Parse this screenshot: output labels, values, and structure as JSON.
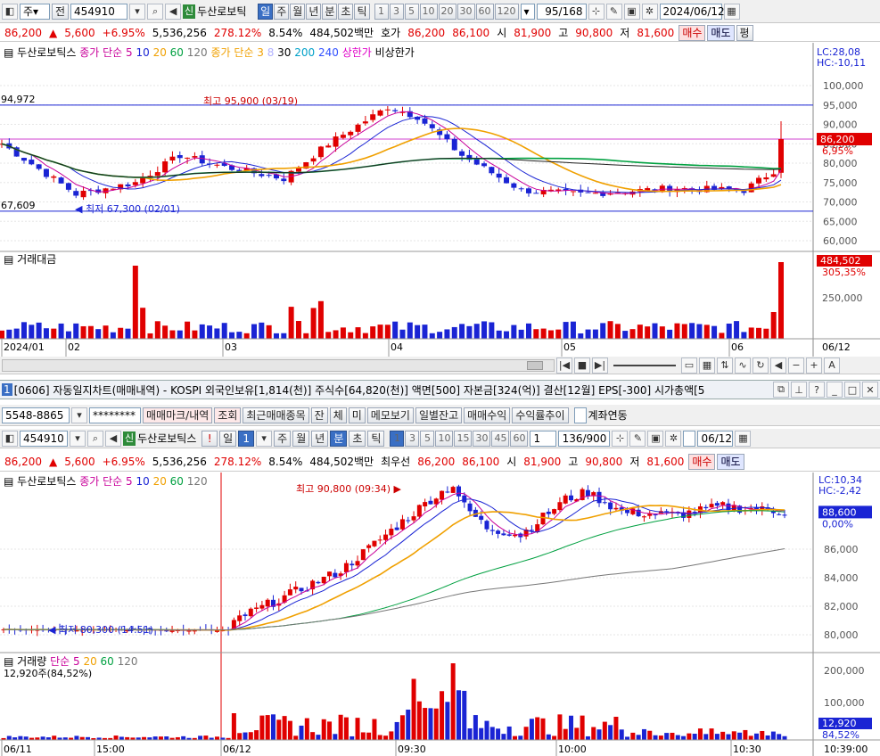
{
  "top": {
    "toolbar": {
      "jong": "주",
      "jeon": "전",
      "code": "454910",
      "sin": "신",
      "name": "두산로보틱",
      "periods": [
        "일",
        "주",
        "월",
        "년",
        "분",
        "초",
        "틱"
      ],
      "active_period": "일",
      "nums": [
        "1",
        "3",
        "5",
        "10",
        "20",
        "30",
        "60",
        "120"
      ],
      "count": "95/168",
      "date": "2024/06/12"
    },
    "quote": {
      "price": "86,200",
      "arrow": "▲",
      "change": "5,600",
      "pct": "+6.95%",
      "volume": "5,536,256",
      "vol_ratio": "278.12%",
      "turnover": "8.54%",
      "amount": "484,502백만",
      "hoga_label": "호가",
      "hoga1": "86,200",
      "hoga2": "86,100",
      "open_label": "시",
      "open": "81,900",
      "high_label": "고",
      "high": "90,800",
      "low_label": "저",
      "low": "81,600",
      "buy": "매수",
      "sell": "매도",
      "avg": "평"
    },
    "legend": {
      "name": "두산로보틱스",
      "ma1": "종가 단순 5",
      "ma1_vals": [
        "10",
        "20",
        "60",
        "120"
      ],
      "ma2": "종가 단순 3",
      "ma2_vals": [
        "8",
        "30",
        "200",
        "240"
      ],
      "upper": "상한가",
      "lower": "비상한가"
    },
    "yaxis": [
      "100,000",
      "95,000",
      "90,000",
      "85,000",
      "80,000",
      "75,000",
      "70,000",
      "65,000",
      "60,000"
    ],
    "lc": "LC:28,08",
    "hc": "HC:-10,11",
    "cur_price": "86,200",
    "cur_pct": "6,95%",
    "left_high": "94,972",
    "left_low": "67,609",
    "high_note": "최고 95,900 (03/19)",
    "low_note": "최저 67,300 (02/01)",
    "vol_label": "거래대금",
    "vol_cur": "484,502",
    "vol_pct": "305,35%",
    "vol_tick": "250,000",
    "xaxis": [
      "2024/01",
      "02",
      "03",
      "04",
      "05",
      "06"
    ],
    "xend": "06/12"
  },
  "window": {
    "title": "[0606] 자동일지차트(매매내역) - KOSPI 외국인보유[1,814(천)] 주식수[64,820(천)] 액면[500] 자본금[324(억)] 결산[12월] EPS[-300] 시가총액[5"
  },
  "bottom": {
    "account": "5548-8865",
    "password": "********",
    "buttons": [
      "매매마크/내역",
      "조회",
      "최근매매종목",
      "잔",
      "체",
      "미",
      "메모보기",
      "일별잔고",
      "매매수익",
      "수익률추이"
    ],
    "link": "계좌연동",
    "toolbar": {
      "code": "454910",
      "sin": "신",
      "name": "두산로보틱스",
      "excl": "!",
      "period": "일",
      "nums": [
        "1",
        "3",
        "5",
        "10",
        "15",
        "30",
        "45",
        "60"
      ],
      "sel": "1",
      "count": "136/900",
      "date": "06/12"
    },
    "quote": {
      "price": "86,200",
      "arrow": "▲",
      "change": "5,600",
      "pct": "+6.95%",
      "volume": "5,536,256",
      "vol_ratio": "278.12%",
      "turnover": "8.54%",
      "amount": "484,502백만",
      "best_label": "최우선",
      "b1": "86,200",
      "b2": "86,100",
      "open_label": "시",
      "open": "81,900",
      "high_label": "고",
      "high": "90,800",
      "low_label": "저",
      "low": "81,600",
      "buy": "매수",
      "sell": "매도"
    },
    "legend": {
      "name": "두산로보틱스",
      "ma": "종가 단순 5",
      "vals": [
        "10",
        "20",
        "60",
        "120"
      ]
    },
    "yaxis": [
      "86,000",
      "84,000",
      "82,000",
      "80,000"
    ],
    "lc": "LC:10,34",
    "hc": "HC:-2,42",
    "cur_price": "88,600",
    "cur_pct": "0,00%",
    "high_note": "최고 90,800 (09:34)",
    "low_note": "최저 80,300 (14:51)",
    "vol_legend": {
      "label": "거래량",
      "ma": "단순 5",
      "vals": [
        "20",
        "60",
        "120"
      ]
    },
    "vol_info": "12,920주(84,52%)",
    "vol_ticks": [
      "200,000",
      "100,000"
    ],
    "vol_cur": "12,920",
    "vol_pct": "84,52%",
    "xaxis": [
      "06/11",
      "15:00",
      "06/12",
      "09:30",
      "10:00",
      "10:30"
    ],
    "xend": "10:39:00"
  },
  "colors": {
    "up": "#e00000",
    "down": "#1a24d4",
    "ma5": "#c8009a",
    "ma10": "#1a24d4",
    "ma20": "#f0a000",
    "ma60": "#00a040",
    "ma120": "#222"
  }
}
